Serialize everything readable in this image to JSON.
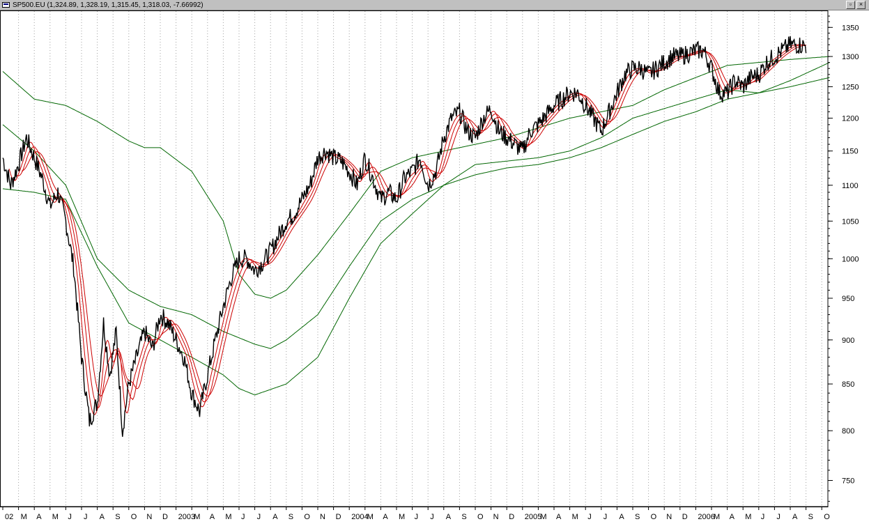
{
  "window": {
    "title": "SP500.EU (1,324.89, 1,328.19, 1,315.45, 1,318.03, -7.66992)",
    "restore_icon": "restore-icon",
    "close_icon": "close-icon"
  },
  "chart_data": {
    "type": "line",
    "title": "",
    "xlabel": "",
    "ylabel": "",
    "y_scale": "log",
    "ylim": [
      725,
      1380
    ],
    "grid": "vertical dotted lines at each month",
    "x_tick_labels": [
      "02",
      "M",
      "A",
      "M",
      "J",
      "J",
      "A",
      "S",
      "O",
      "N",
      "D",
      "2003",
      "M",
      "A",
      "M",
      "J",
      "J",
      "A",
      "S",
      "O",
      "N",
      "D",
      "2004",
      "M",
      "A",
      "M",
      "J",
      "J",
      "A",
      "S",
      "O",
      "N",
      "D",
      "2005",
      "M",
      "A",
      "M",
      "J",
      "J",
      "A",
      "S",
      "O",
      "N",
      "D",
      "2006",
      "M",
      "A",
      "M",
      "J",
      "J",
      "A",
      "S",
      "O"
    ],
    "y_ticks": [
      750,
      800,
      850,
      900,
      950,
      1000,
      1050,
      1100,
      1150,
      1200,
      1250,
      1300,
      1350
    ],
    "price_series": {
      "name": "",
      "color": "#000000",
      "x_months": [
        0,
        0.5,
        1,
        1.5,
        2,
        2.5,
        3,
        3.5,
        4,
        4.5,
        5,
        5.5,
        6,
        6.4,
        6.8,
        7.2,
        7.6,
        8,
        8.5,
        9,
        9.5,
        10,
        10.5,
        11,
        11.5,
        12,
        12.5,
        13,
        13.5,
        14,
        14.5,
        15,
        15.5,
        16,
        16.5,
        17,
        17.5,
        18,
        18.5,
        19,
        19.5,
        20,
        20.5,
        21,
        21.5,
        22,
        22.5,
        23,
        23.5,
        24,
        24.5,
        25,
        25.5,
        26,
        26.5,
        27,
        27.5,
        28,
        28.5,
        29,
        29.5,
        30,
        30.5,
        31,
        31.5,
        32,
        32.5,
        33,
        33.5,
        34,
        34.5,
        35,
        35.5,
        36,
        36.5,
        37,
        37.5,
        38,
        38.5,
        39,
        39.5,
        40,
        40.5,
        41,
        41.5,
        42,
        42.5,
        43,
        43.5,
        44,
        44.5,
        45,
        45.5,
        46,
        46.5,
        47,
        47.5,
        48,
        48.5,
        49,
        49.5,
        50,
        50.5,
        51,
        51.5,
        52,
        52.5
      ],
      "values": [
        1140,
        1100,
        1130,
        1170,
        1140,
        1110,
        1070,
        1090,
        1050,
        990,
        880,
        810,
        830,
        920,
        860,
        910,
        800,
        850,
        880,
        910,
        890,
        930,
        920,
        900,
        880,
        840,
        820,
        860,
        900,
        940,
        975,
        1000,
        1000,
        985,
        995,
        1010,
        1030,
        1050,
        1060,
        1080,
        1100,
        1140,
        1150,
        1140,
        1135,
        1120,
        1100,
        1140,
        1110,
        1080,
        1090,
        1080,
        1110,
        1120,
        1140,
        1100,
        1120,
        1170,
        1200,
        1210,
        1180,
        1170,
        1200,
        1215,
        1180,
        1170,
        1160,
        1150,
        1180,
        1190,
        1205,
        1220,
        1230,
        1240,
        1240,
        1220,
        1200,
        1180,
        1210,
        1240,
        1270,
        1280,
        1280,
        1270,
        1280,
        1290,
        1300,
        1300,
        1305,
        1310,
        1310,
        1280,
        1240,
        1240,
        1260,
        1250,
        1265,
        1270,
        1290,
        1300,
        1310,
        1320,
        1320,
        1318
      ]
    },
    "fast_averages": {
      "name": "",
      "color": "#cc0000",
      "lags_months": [
        0.4,
        0.8,
        1.2
      ]
    },
    "slow_averages": {
      "name": "",
      "color": "#006600",
      "series": [
        {
          "x_months": [
            0,
            2,
            4,
            6,
            8,
            10,
            12,
            14,
            15,
            16,
            18,
            20,
            22,
            24,
            26,
            28,
            30,
            32,
            34,
            36,
            38,
            40,
            42,
            44,
            46,
            48,
            50,
            52.5
          ],
          "values": [
            1095,
            1090,
            1080,
            990,
            920,
            900,
            880,
            860,
            845,
            838,
            850,
            880,
            950,
            1020,
            1060,
            1100,
            1130,
            1135,
            1140,
            1150,
            1170,
            1200,
            1215,
            1230,
            1245,
            1240,
            1260,
            1290
          ]
        },
        {
          "x_months": [
            0,
            2,
            4,
            6,
            8,
            10,
            12,
            14,
            16,
            17,
            18,
            20,
            22,
            24,
            26,
            28,
            30,
            32,
            34,
            36,
            38,
            40,
            42,
            44,
            46,
            48,
            50,
            52.5
          ],
          "values": [
            1190,
            1150,
            1100,
            1000,
            960,
            940,
            930,
            910,
            895,
            890,
            900,
            930,
            990,
            1050,
            1080,
            1100,
            1115,
            1125,
            1130,
            1140,
            1155,
            1175,
            1195,
            1210,
            1230,
            1240,
            1250,
            1265
          ]
        },
        {
          "x_months": [
            0,
            2,
            4,
            6,
            8,
            9,
            10,
            12,
            14,
            15,
            16,
            17,
            18,
            20,
            22,
            24,
            26,
            28,
            30,
            32,
            34,
            36,
            38,
            40,
            42,
            44,
            46,
            48,
            50,
            52.5
          ],
          "values": [
            1275,
            1230,
            1220,
            1195,
            1165,
            1155,
            1155,
            1120,
            1050,
            980,
            955,
            950,
            960,
            1005,
            1060,
            1120,
            1140,
            1150,
            1160,
            1170,
            1185,
            1200,
            1210,
            1220,
            1245,
            1265,
            1285,
            1290,
            1295,
            1300
          ]
        }
      ]
    }
  }
}
